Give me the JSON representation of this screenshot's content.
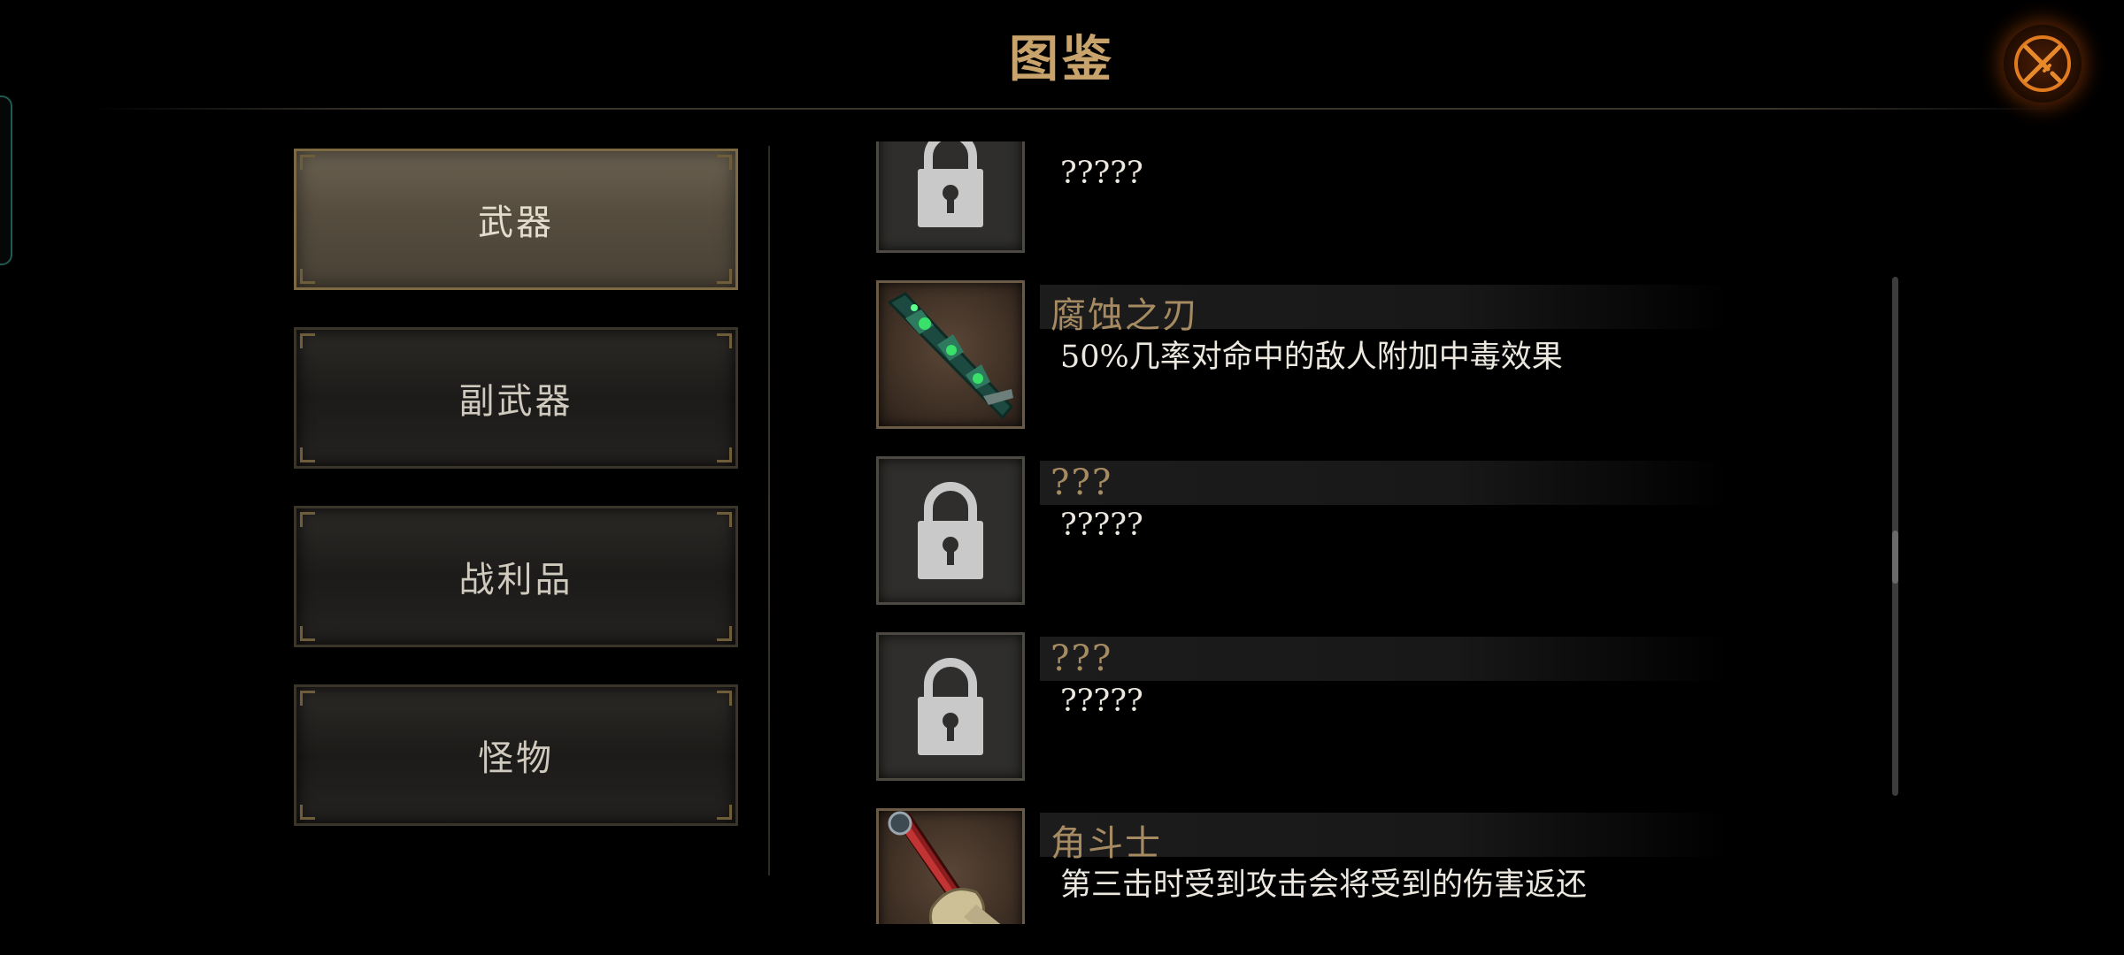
{
  "header": {
    "title": "图鉴",
    "close_icon": "close-crossed-swords-icon"
  },
  "nav": {
    "items": [
      {
        "label": "武器",
        "active": true
      },
      {
        "label": "副武器",
        "active": false
      },
      {
        "label": "战利品",
        "active": false
      },
      {
        "label": "怪物",
        "active": false
      }
    ]
  },
  "entries": [
    {
      "name": "",
      "desc": "?????",
      "locked": true,
      "icon": "lock-icon"
    },
    {
      "name": "腐蚀之刃",
      "desc": "50%几率对命中的敌人附加中毒效果",
      "locked": false,
      "icon": "poison-blade-icon"
    },
    {
      "name": "???",
      "desc": "?????",
      "locked": true,
      "icon": "lock-icon"
    },
    {
      "name": "???",
      "desc": "?????",
      "locked": true,
      "icon": "lock-icon"
    },
    {
      "name": "角斗士",
      "desc": "第三击时受到攻击会将受到的伤害返还",
      "locked": false,
      "icon": "gladiator-sword-icon"
    }
  ],
  "colors": {
    "title": "#c8a36c",
    "item_name": "#a58a62",
    "desc": "#ece8e0",
    "close_glow": "#c8500a"
  }
}
